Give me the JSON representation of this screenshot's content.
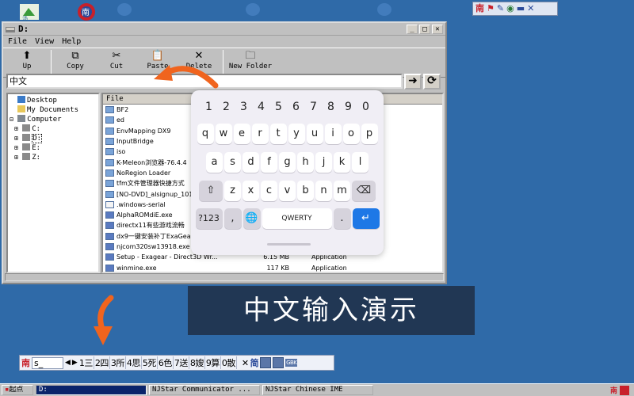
{
  "window": {
    "title": "D:",
    "menu": [
      "File",
      "View",
      "Help"
    ],
    "toolbar": [
      "Up",
      "Copy",
      "Cut",
      "Paste",
      "Delete",
      "New Folder"
    ],
    "address_value": "中文"
  },
  "tree": [
    "Desktop",
    "My Documents",
    "Computer",
    "C:",
    "D:",
    "E:",
    "Z:"
  ],
  "files": {
    "header": "File",
    "rows": [
      {
        "name": "BF2",
        "size": "",
        "type": ""
      },
      {
        "name": "ed",
        "size": "",
        "type": ""
      },
      {
        "name": "EnvMapping DX9",
        "size": "",
        "type": ""
      },
      {
        "name": "InputBridge",
        "size": "",
        "type": ""
      },
      {
        "name": "iso",
        "size": "",
        "type": ""
      },
      {
        "name": "K-Meleon浏览器-76.4.4",
        "size": "",
        "type": ""
      },
      {
        "name": "NoRegion Loader",
        "size": "",
        "type": ""
      },
      {
        "name": "tfm文件管理器快捷方式",
        "size": "",
        "type": ""
      },
      {
        "name": "[NO-DVD]_alsignup_1010",
        "size": "",
        "type": ""
      },
      {
        "name": ".windows-serial",
        "size": "",
        "type": ""
      },
      {
        "name": "AlphaROMdiE.exe",
        "size": "",
        "type": ""
      },
      {
        "name": "directx11有些游戏流畅",
        "size": "",
        "type": ""
      },
      {
        "name": "dx9一键安装补丁ExaGear",
        "size": "",
        "type": ""
      },
      {
        "name": "njcom320sw13918.exe",
        "size": "",
        "type": ""
      },
      {
        "name": "Setup - Exagear - Direct3D Wr...",
        "size": "6.15 MB",
        "type": "Application"
      },
      {
        "name": "winmine.exe",
        "size": "117 KB",
        "type": "Application"
      }
    ]
  },
  "keyboard": {
    "numbers": [
      "1",
      "2",
      "3",
      "4",
      "5",
      "6",
      "7",
      "8",
      "9",
      "0"
    ],
    "row1": [
      "q",
      "w",
      "e",
      "r",
      "t",
      "y",
      "u",
      "i",
      "o",
      "p"
    ],
    "row2": [
      "a",
      "s",
      "d",
      "f",
      "g",
      "h",
      "j",
      "k",
      "l"
    ],
    "row3": [
      "z",
      "x",
      "c",
      "v",
      "b",
      "n",
      "m"
    ],
    "mode_key": "?123",
    "comma": ",",
    "space_label": "QWERTY",
    "period": ".",
    "enter": "↵"
  },
  "caption": "中文输入演示",
  "ime_bar": {
    "mode": "南",
    "input": "s_",
    "candidates": [
      "1三",
      "2四",
      "3所",
      "4思",
      "5死",
      "6色",
      "7送",
      "8嫂",
      "9算",
      "0散"
    ],
    "extra": [
      "✕",
      "简",
      "GBK"
    ]
  },
  "taskbar": {
    "start": "起点",
    "tasks": [
      "D:",
      "NJStar Communicator ...",
      "NJStar Chinese IME"
    ],
    "tray": "南"
  },
  "colors": {
    "desktop": "#2f6aa8",
    "accent_arrow": "#f0641e",
    "enter_key": "#1e78e6"
  }
}
